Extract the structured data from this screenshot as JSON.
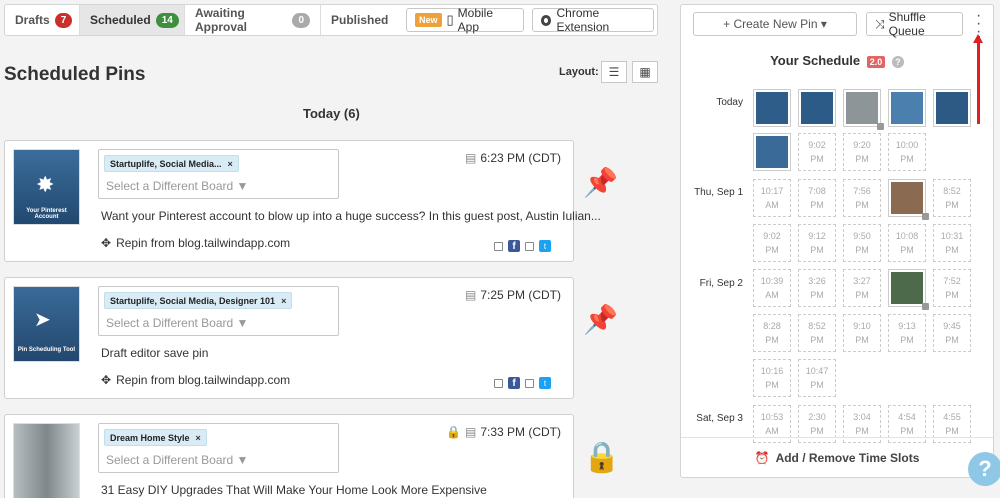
{
  "tabs": [
    {
      "label": "Drafts",
      "count": "7",
      "color": "#c9302c"
    },
    {
      "label": "Scheduled",
      "count": "14",
      "color": "#3f8f3f"
    },
    {
      "label": "Awaiting Approval",
      "count": "0",
      "color": "#aaaaaa"
    },
    {
      "label": "Published",
      "count": ""
    }
  ],
  "toolbar": {
    "new_tag": "New",
    "mobile_app": "Mobile App",
    "chrome_extension": "Chrome Extension"
  },
  "page": {
    "title": "Scheduled Pins",
    "layout_label": "Layout:",
    "day_heading": "Today (6)"
  },
  "pins": [
    {
      "board": "Startuplife, Social Media...",
      "board_placeholder": "Select a Different Board ▼",
      "time": "6:23 PM (CDT)",
      "description": "Want your Pinterest account to blow up into a huge success? In this guest post, Austin Iulian...",
      "repin": "Repin from blog.tailwindapp.com",
      "thumb_title": "Your Pinterest Account",
      "thumb_color": "#2f5d8a"
    },
    {
      "board": "Startuplife, Social Media, Designer 101",
      "board_placeholder": "Select a Different Board ▼",
      "time": "7:25 PM (CDT)",
      "description": "Draft editor save pin",
      "repin": "Repin from blog.tailwindapp.com",
      "thumb_title": "Pin Scheduling Tool",
      "thumb_color": "#2c5b87"
    },
    {
      "board": "Dream Home Style",
      "board_placeholder": "Select a Different Board ▼",
      "time": "7:33 PM (CDT)",
      "description": "31 Easy DIY Upgrades That Will Make Your Home Look More Expensive",
      "repin": "",
      "thumb_title": "",
      "thumb_color": "#9aa3a8"
    }
  ],
  "panel": {
    "create_button": "+ Create New Pin ▾",
    "shuffle_button": "Shuffle Queue",
    "title": "Your Schedule",
    "version": "2.0",
    "footer": "Add / Remove Time Slots",
    "rows": [
      {
        "label": "Today"
      },
      {
        "label": "Thu, Sep 1"
      },
      {
        "label": "Fri, Sep 2"
      },
      {
        "label": "Sat, Sep 3"
      }
    ],
    "slots": {
      "today_row2": [
        [
          "9:02",
          "PM"
        ],
        [
          "9:20",
          "PM"
        ],
        [
          "10:00",
          "PM"
        ]
      ],
      "thu_row1": [
        [
          "10:17",
          "AM"
        ],
        [
          "7:08",
          "PM"
        ],
        [
          "7:56",
          "PM"
        ],
        [
          "8:52",
          "PM"
        ]
      ],
      "thu_row2": [
        [
          "9:02",
          "PM"
        ],
        [
          "9:12",
          "PM"
        ],
        [
          "9:50",
          "PM"
        ],
        [
          "10:08",
          "PM"
        ],
        [
          "10:31",
          "PM"
        ]
      ],
      "fri_row1": [
        [
          "10:39",
          "AM"
        ],
        [
          "3:26",
          "PM"
        ],
        [
          "3:27",
          "PM"
        ],
        [
          "7:52",
          "PM"
        ]
      ],
      "fri_row2": [
        [
          "8:28",
          "PM"
        ],
        [
          "8:52",
          "PM"
        ],
        [
          "9:10",
          "PM"
        ],
        [
          "9:13",
          "PM"
        ],
        [
          "9:45",
          "PM"
        ]
      ],
      "fri_row3": [
        [
          "10:16",
          "PM"
        ],
        [
          "10:47",
          "PM"
        ]
      ],
      "sat_row1": [
        [
          "10:53",
          "AM"
        ],
        [
          "2:30",
          "PM"
        ],
        [
          "3:04",
          "PM"
        ],
        [
          "4:54",
          "PM"
        ],
        [
          "4:55",
          "PM"
        ]
      ]
    }
  },
  "help": "?"
}
